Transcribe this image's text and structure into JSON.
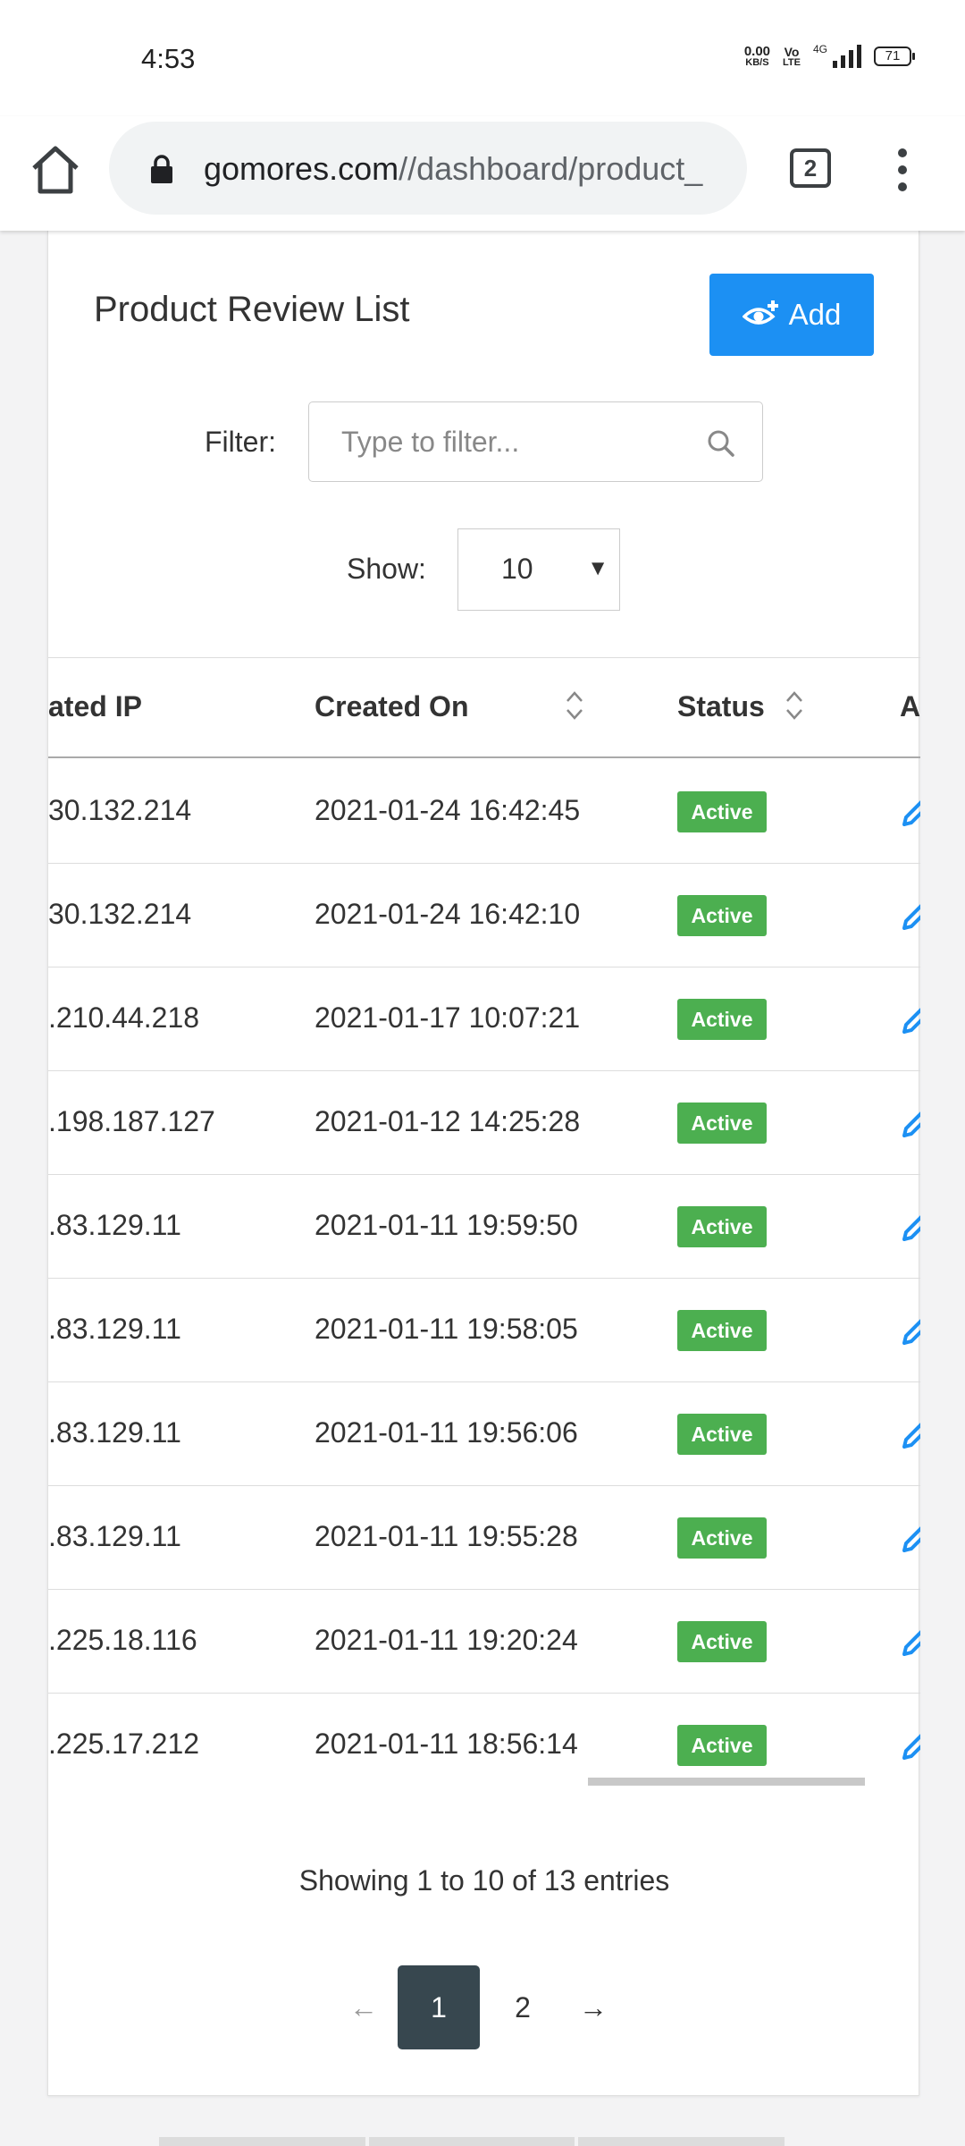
{
  "status_bar": {
    "time": "4:53",
    "net_speed_value": "0.00",
    "net_speed_unit": "KB/S",
    "volte_top": "Vo",
    "volte_bottom": "LTE",
    "network_type": "4G",
    "battery": "71"
  },
  "browser": {
    "url_domain": "gomores.com",
    "url_path": "//dashboard/product_",
    "tab_count": "2"
  },
  "page": {
    "title": "Product Review List",
    "add_label": "Add",
    "filter_label": "Filter:",
    "filter_placeholder": "Type to filter...",
    "show_label": "Show:",
    "show_value": "10"
  },
  "table": {
    "columns": [
      "ated IP",
      "Created On",
      "Status",
      "A"
    ],
    "rows": [
      {
        "ip": "30.132.214",
        "created": "2021-01-24 16:42:45",
        "status": "Active"
      },
      {
        "ip": "30.132.214",
        "created": "2021-01-24 16:42:10",
        "status": "Active"
      },
      {
        "ip": ".210.44.218",
        "created": "2021-01-17 10:07:21",
        "status": "Active"
      },
      {
        "ip": ".198.187.127",
        "created": "2021-01-12 14:25:28",
        "status": "Active"
      },
      {
        "ip": ".83.129.11",
        "created": "2021-01-11 19:59:50",
        "status": "Active"
      },
      {
        "ip": ".83.129.11",
        "created": "2021-01-11 19:58:05",
        "status": "Active"
      },
      {
        "ip": ".83.129.11",
        "created": "2021-01-11 19:56:06",
        "status": "Active"
      },
      {
        "ip": ".83.129.11",
        "created": "2021-01-11 19:55:28",
        "status": "Active"
      },
      {
        "ip": ".225.18.116",
        "created": "2021-01-11 19:20:24",
        "status": "Active"
      },
      {
        "ip": ".225.17.212",
        "created": "2021-01-11 18:56:14",
        "status": "Active"
      }
    ]
  },
  "footer": {
    "entries_info": "Showing 1 to 10 of 13 entries",
    "pagination": {
      "prev": "←",
      "pages": [
        "1",
        "2"
      ],
      "next": "→"
    }
  },
  "colors": {
    "primary": "#1c90f3",
    "active_badge": "#4caf50",
    "active_page": "#37474f",
    "edit_icon": "#1c90f3"
  }
}
